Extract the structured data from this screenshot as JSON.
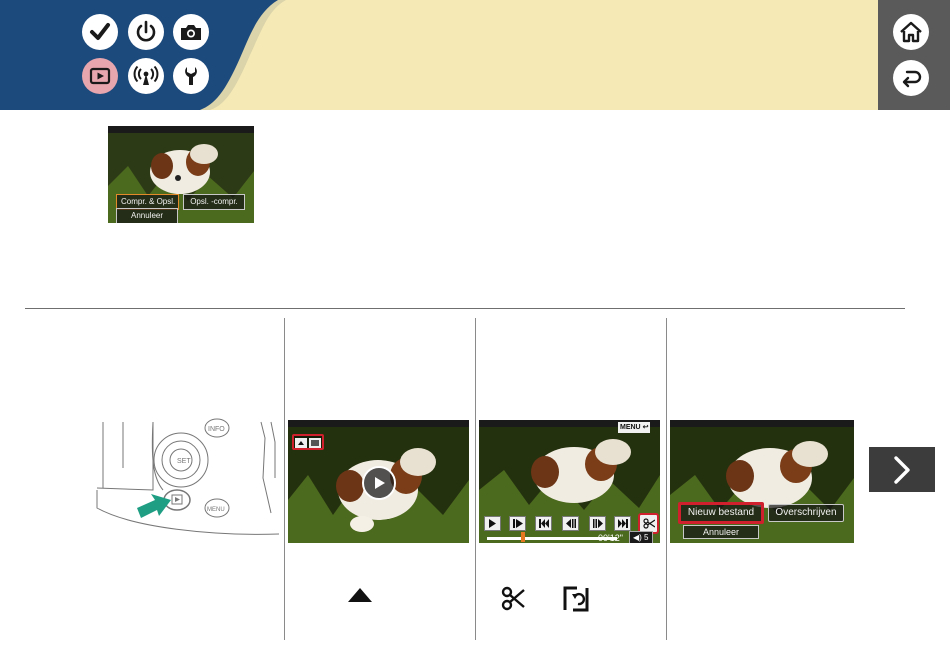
{
  "header": {
    "nav_icons": [
      "check-icon",
      "power-icon",
      "camera-icon",
      "playback-icon",
      "wireless-icon",
      "wrench-icon"
    ],
    "active_icon": "playback-icon",
    "side_icons": [
      "home-icon",
      "back-icon"
    ]
  },
  "top_preview": {
    "buttons": [
      "Compr. & Opsl.",
      "Opsl. -compr.",
      "Annuleer"
    ]
  },
  "step2_screen": {
    "icons": [
      "play-icon",
      "mode-indicator-icon"
    ]
  },
  "step3_screen": {
    "menu_label": "MENU",
    "controls": [
      "play-icon",
      "slow-motion-icon",
      "first-frame-icon",
      "previous-frame-icon",
      "next-frame-icon",
      "last-frame-icon",
      "cut-icon"
    ],
    "timecode": "00'12\"",
    "volume": "5"
  },
  "step4_screen": {
    "buttons": [
      "Nieuw bestand",
      "Overschrijven",
      "Annuleer"
    ]
  },
  "captions": {
    "step2_icon": "up-triangle-icon",
    "step3_icons": [
      "scissors-icon",
      "trim-save-icon"
    ]
  },
  "navigation": {
    "next_icon": "chevron-right-icon"
  },
  "colors": {
    "header_blue": "#1d4a7c",
    "header_cream": "#f5eab6",
    "header_gray": "#5a5a5a",
    "active_pink": "#e7a5ad",
    "highlight_red": "#d0202d",
    "playhead_orange": "#e87722"
  }
}
